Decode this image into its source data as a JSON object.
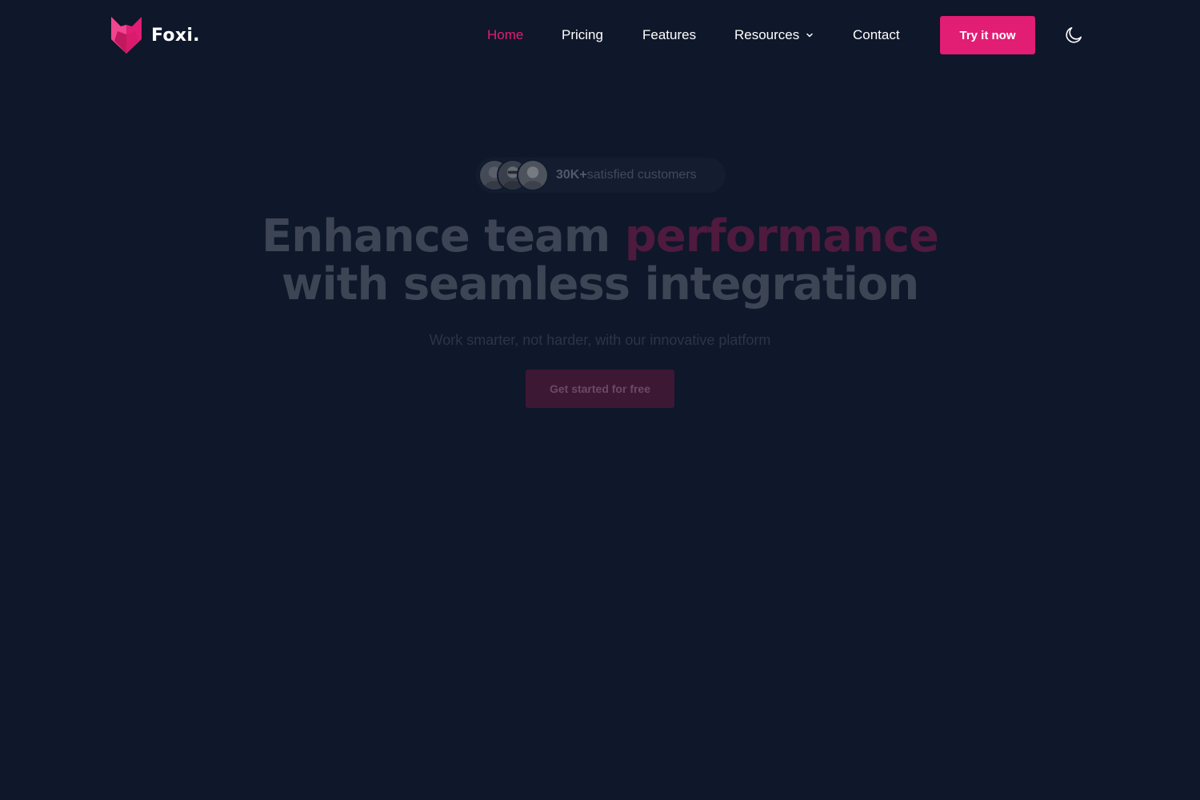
{
  "brand": {
    "name": "Foxi.",
    "logo_icon": "fox-head-icon",
    "accent_color": "#e11d74"
  },
  "nav": {
    "items": [
      {
        "label": "Home",
        "active": true
      },
      {
        "label": "Pricing",
        "active": false
      },
      {
        "label": "Features",
        "active": false
      },
      {
        "label": "Resources",
        "active": false,
        "has_dropdown": true
      },
      {
        "label": "Contact",
        "active": false
      }
    ],
    "cta_label": "Try it now",
    "theme_toggle_icon": "moon-icon"
  },
  "hero": {
    "social_proof": {
      "count": "30K+",
      "label": "satisfied customers"
    },
    "headline": {
      "part1": "Enhance team ",
      "accent": "performance",
      "part2": "with seamless integration"
    },
    "subtitle": "Work smarter, not harder, with our innovative platform",
    "cta_label": "Get started for free"
  },
  "colors": {
    "background": "#0f172a",
    "text": "#ffffff"
  }
}
